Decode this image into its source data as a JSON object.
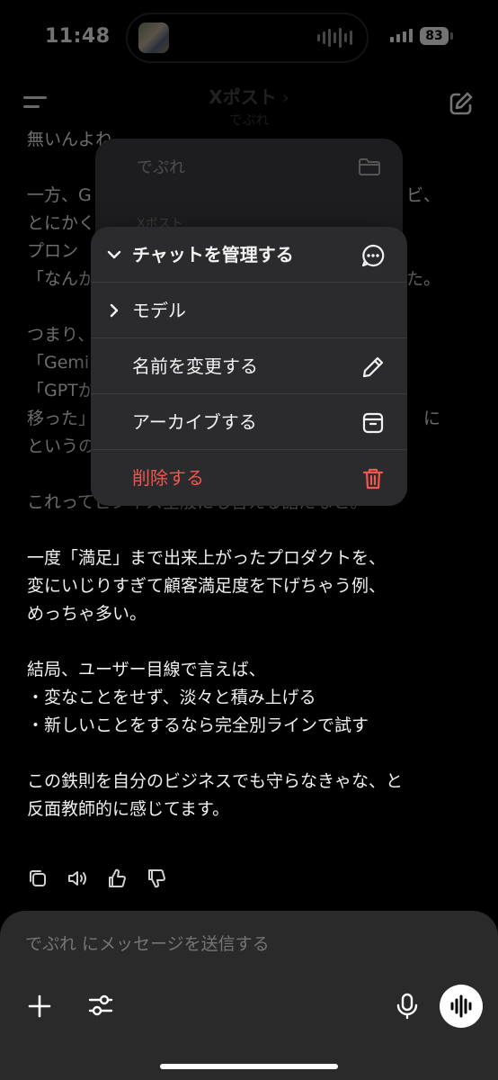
{
  "status_bar": {
    "time": "11:48",
    "battery": "83"
  },
  "header": {
    "title": "Xポスト",
    "subtitle": "でぷれ"
  },
  "chat": {
    "lines": [
      "無いんよね。",
      "",
      "一方、G",
      "とにかく",
      "プロン",
      "「なんか",
      "",
      "つまり、",
      "「Gemin",
      "「GPTか",
      "移った」",
      "というの",
      "",
      "これってビジネス全般にも言える話だなと。",
      "",
      "一度「満足」まで出来上がったプロダクトを、",
      "変にいじりすぎて顧客満足度を下げちゃう例、",
      "めっちゃ多い。",
      "",
      "結局、ユーザー目線で言えば、",
      "・変なことをせず、淡々と積み上げる",
      "・新しいことをするなら完全別ラインで試す",
      "",
      "この鉄則を自分のビジネスでも守らなきゃな、と",
      "反面教師的に感じてます。"
    ],
    "line_tails": {
      "2": "ビ、",
      "5": "た。",
      "10": "に"
    }
  },
  "back_menu": {
    "project_label": "でぷれ",
    "item_label": "Xポスト"
  },
  "context_menu": {
    "items": [
      {
        "label": "チャットを管理する",
        "lead": "chevron-down",
        "icon": "ellipsis-circle-icon"
      },
      {
        "label": "モデル",
        "lead": "chevron-right",
        "icon": ""
      },
      {
        "label": "名前を変更する",
        "lead": "",
        "icon": "pencil-icon"
      },
      {
        "label": "アーカイブする",
        "lead": "",
        "icon": "archive-box-icon"
      },
      {
        "label": "削除する",
        "lead": "",
        "icon": "trash-icon"
      }
    ],
    "danger_color": "#f0574f"
  },
  "message_actions": [
    "copy-icon",
    "speaker-icon",
    "thumbs-up-icon",
    "thumbs-down-icon"
  ],
  "composer": {
    "placeholder": "でぷれ にメッセージを送信する"
  }
}
